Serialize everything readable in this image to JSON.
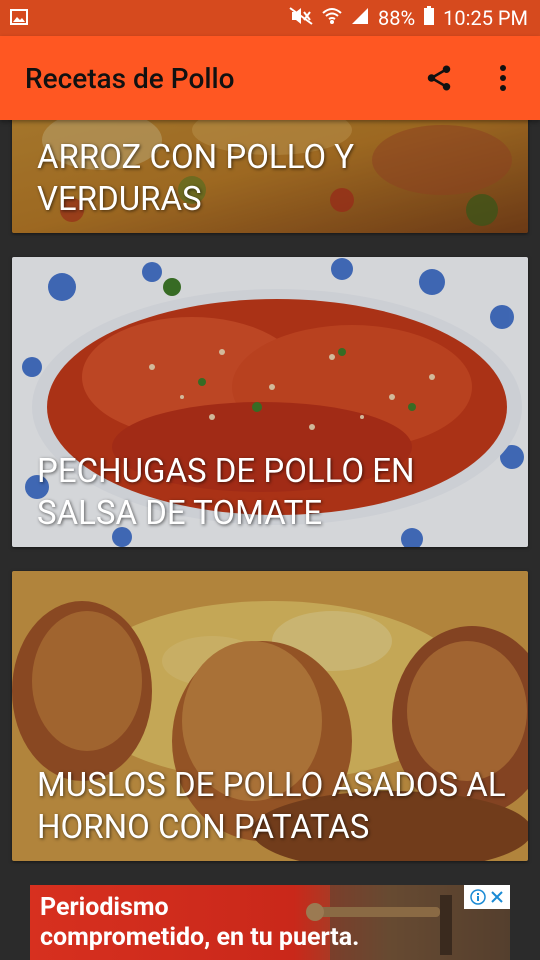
{
  "status_bar": {
    "battery": "88%",
    "time": "10:25 PM"
  },
  "app_bar": {
    "title": "Recetas de Pollo",
    "share_icon": "share-icon",
    "menu_icon": "more-vert-icon"
  },
  "recipes": [
    {
      "title": "ARROZ CON POLLO Y VERDURAS"
    },
    {
      "title": "PECHUGAS DE POLLO EN SALSA DE TOMATE"
    },
    {
      "title": "MUSLOS DE POLLO ASADOS AL HORNO CON PATATAS"
    }
  ],
  "ad": {
    "line1": "Periodismo",
    "line2": "comprometido, en tu puerta."
  },
  "colors": {
    "primary": "#FF5722",
    "primary_dark": "#D64A1E",
    "background": "#2B2B2B"
  }
}
